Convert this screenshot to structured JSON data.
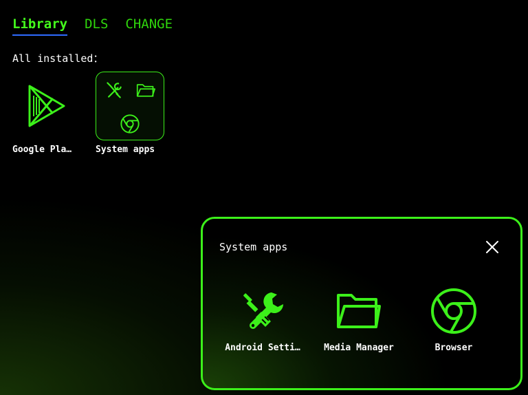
{
  "tabs": [
    {
      "label": "Library",
      "active": true
    },
    {
      "label": "DLS",
      "active": false
    },
    {
      "label": "CHANGE",
      "active": false
    }
  ],
  "section": {
    "label": "All installed："
  },
  "apps": [
    {
      "label": "Google Pla…",
      "icon": "google-play-icon"
    },
    {
      "label": "System apps",
      "icon": "folder-icon"
    }
  ],
  "dialog": {
    "title": "System apps",
    "close_icon": "close-icon",
    "apps": [
      {
        "label": "Android Setti…",
        "icon": "settings-tools-icon"
      },
      {
        "label": "Media Manager",
        "icon": "folder-icon"
      },
      {
        "label": "Browser",
        "icon": "chrome-icon"
      }
    ]
  },
  "colors": {
    "accent": "#3cf01a",
    "tab_underline": "#2f6bff",
    "background": "#000000"
  }
}
